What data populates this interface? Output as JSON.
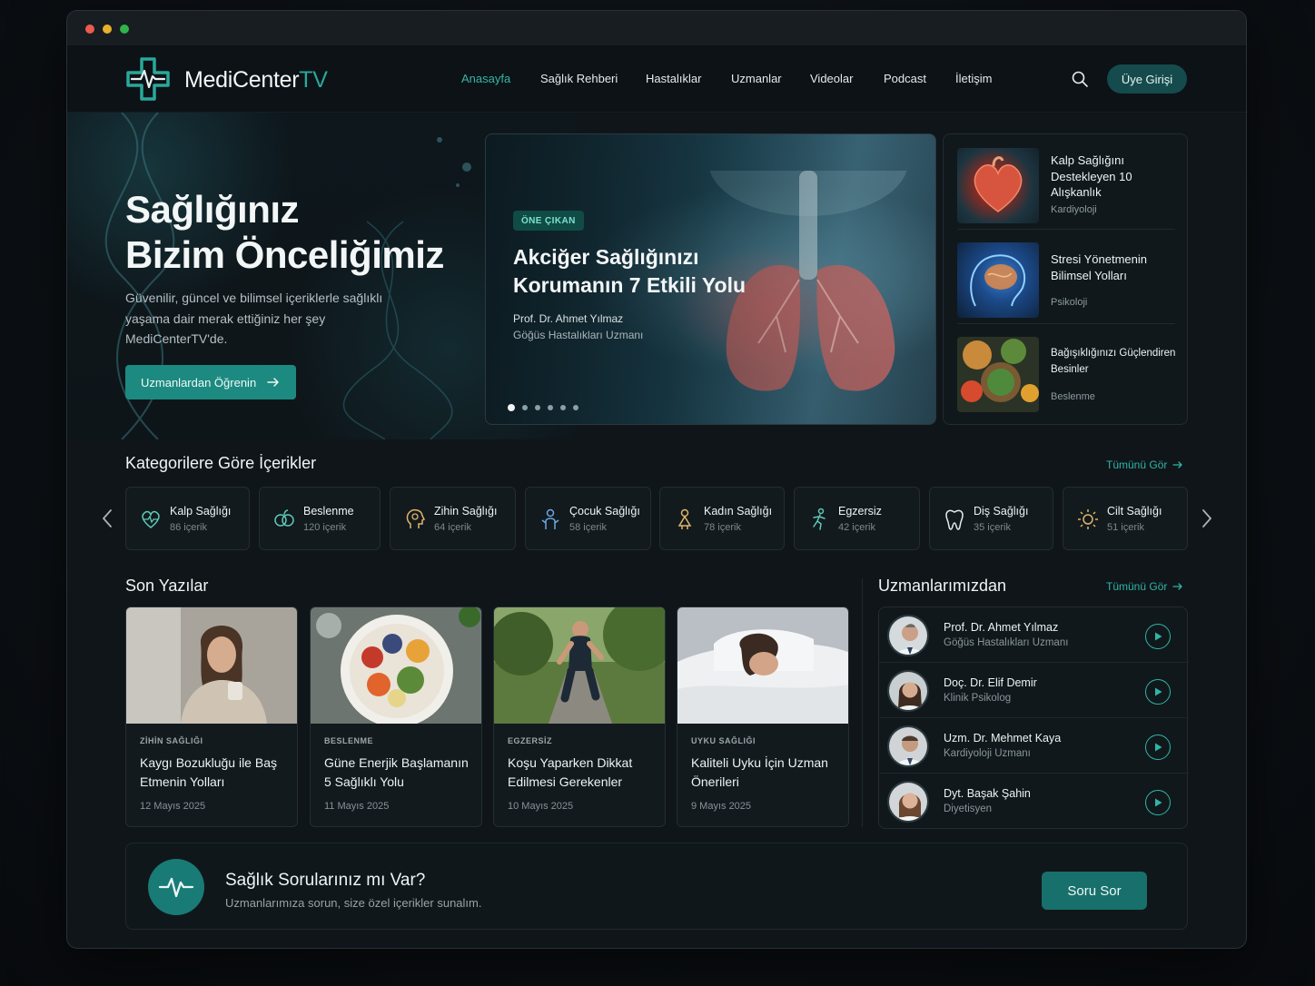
{
  "brand": {
    "name": "MediCenter",
    "suffix": "TV",
    "accent": "#2aa89a"
  },
  "nav": {
    "items": [
      {
        "label": "Anasayfa",
        "active": true
      },
      {
        "label": "Sağlık Rehberi"
      },
      {
        "label": "Hastalıklar"
      },
      {
        "label": "Uzmanlar"
      },
      {
        "label": "Videolar"
      },
      {
        "label": "Podcast"
      },
      {
        "label": "İletişim"
      }
    ],
    "search_icon": "search-icon",
    "login_label": "Üye Girişi"
  },
  "hero": {
    "title_line1": "Sağlığınız",
    "title_line2": "Bizim Önceliğimiz",
    "description": "Güvenilir, güncel ve bilimsel içeriklerle sağlıklı yaşama dair merak ettiğiniz her şey MediCenterTV'de.",
    "cta_label": "Uzmanlardan Öğrenin"
  },
  "featured": {
    "badge": "ÖNE ÇIKAN",
    "title": "Akciğer Sağlığınızı Korumanın 7 Etkili Yolu",
    "author": "Prof. Dr. Ahmet Yılmaz",
    "role": "Göğüs Hastalıkları Uzmanı",
    "slides_total": 6,
    "active_slide": 1
  },
  "side_articles": [
    {
      "title": "Kalp Sağlığını Destekleyen 10 Alışkanlık",
      "category": "Kardiyoloji",
      "image": "heart"
    },
    {
      "title": "Stresi Yönetmenin Bilimsel Yolları",
      "category": "Psikoloji",
      "image": "brain"
    },
    {
      "title": "Bağışıklığınızı Güçlendiren Besinler",
      "category": "Beslenme",
      "image": "food"
    }
  ],
  "categories": {
    "title": "Kategorilere Göre İçerikler",
    "see_all": "Tümünü Gör",
    "items": [
      {
        "name": "Kalp Sağlığı",
        "count": "86 içerik",
        "icon": "heart-icon"
      },
      {
        "name": "Beslenme",
        "count": "120 içerik",
        "icon": "nutrition-icon"
      },
      {
        "name": "Zihin Sağlığı",
        "count": "64 içerik",
        "icon": "mind-icon"
      },
      {
        "name": "Çocuk Sağlığı",
        "count": "58 içerik",
        "icon": "child-icon"
      },
      {
        "name": "Kadın Sağlığı",
        "count": "78 içerik",
        "icon": "woman-icon"
      },
      {
        "name": "Egzersiz",
        "count": "42 içerik",
        "icon": "exercise-icon"
      },
      {
        "name": "Diş Sağlığı",
        "count": "35 içerik",
        "icon": "tooth-icon"
      },
      {
        "name": "Cilt Sağlığı",
        "count": "51 içerik",
        "icon": "skin-icon"
      }
    ]
  },
  "recent": {
    "title": "Son Yazılar",
    "posts": [
      {
        "category": "ZİHİN SAĞLIĞI",
        "title": "Kaygı Bozukluğu ile Baş Etmenin Yolları",
        "date": "12 Mayıs 2025",
        "image": "woman-tea"
      },
      {
        "category": "BESLENME",
        "title": "Güne Enerjik Başlamanın 5 Sağlıklı Yolu",
        "date": "11 Mayıs 2025",
        "image": "bowl"
      },
      {
        "category": "EGZERSİZ",
        "title": "Koşu Yaparken Dikkat Edilmesi Gerekenler",
        "date": "10 Mayıs 2025",
        "image": "runner"
      },
      {
        "category": "UYKU SAĞLIĞI",
        "title": "Kaliteli Uyku İçin Uzman Önerileri",
        "date": "9 Mayıs 2025",
        "image": "sleep"
      }
    ]
  },
  "experts": {
    "title": "Uzmanlarımızdan",
    "see_all": "Tümünü Gör",
    "items": [
      {
        "name": "Prof. Dr. Ahmet Yılmaz",
        "role": "Göğüs Hastalıkları Uzmanı"
      },
      {
        "name": "Doç. Dr. Elif Demir",
        "role": "Klinik Psikolog"
      },
      {
        "name": "Uzm. Dr. Mehmet Kaya",
        "role": "Kardiyoloji Uzmanı"
      },
      {
        "name": "Dyt. Başak Şahin",
        "role": "Diyetisyen"
      }
    ]
  },
  "qa": {
    "title": "Sağlık Sorularınız mı Var?",
    "subtitle": "Uzmanlarımıza sorun, size özel içerikler sunalım.",
    "button_label": "Soru Sor"
  }
}
